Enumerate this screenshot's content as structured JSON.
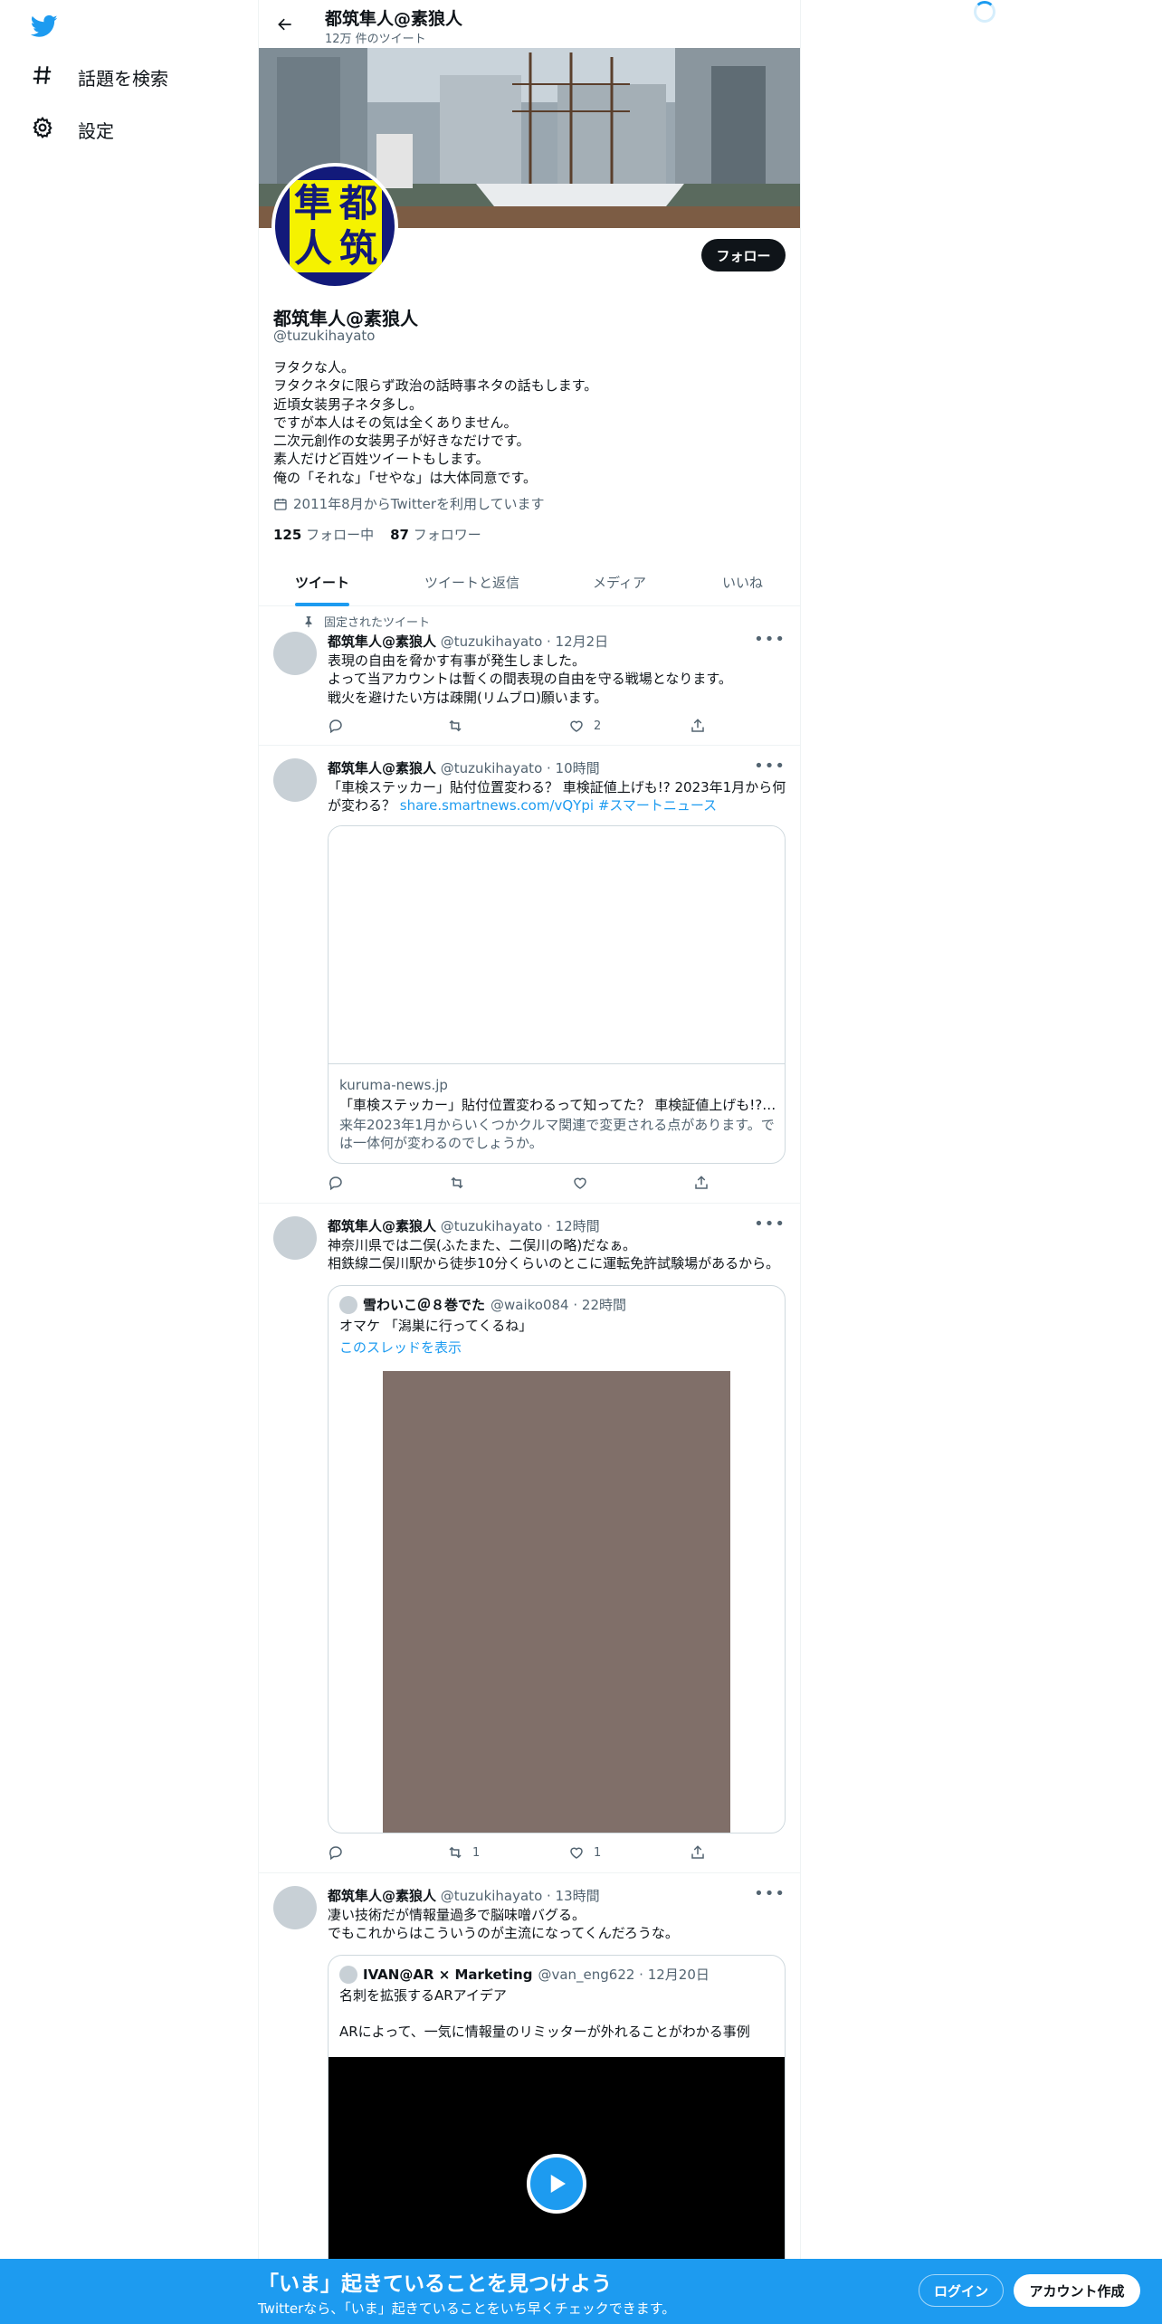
{
  "nav": {
    "items": [
      {
        "label": "話題を検索"
      },
      {
        "label": "設定"
      }
    ]
  },
  "header": {
    "title": "都筑隼人@素狼人",
    "subtitle": "12万 件のツイート"
  },
  "profile": {
    "avatar_text": [
      "隼",
      "都",
      "人",
      "筑"
    ],
    "follow_label": "フォロー",
    "name": "都筑隼人@素狼人",
    "handle": "@tuzukihayato",
    "bio": [
      "ヲタクな人。",
      "ヲタクネタに限らず政治の話時事ネタの話もします。",
      "近頃女装男子ネタ多し。",
      "ですが本人はその気は全くありません。",
      "二次元創作の女装男子が好きなだけです。",
      "素人だけど百姓ツイートもします。",
      "俺の「それな」「せやな」は大体同意です。"
    ],
    "joined": "2011年8月からTwitterを利用しています",
    "following_count": "125",
    "following_label": "フォロー中",
    "followers_count": "87",
    "followers_label": "フォロワー"
  },
  "tabs": [
    {
      "label": "ツイート",
      "active": true
    },
    {
      "label": "ツイートと返信",
      "active": false
    },
    {
      "label": "メディア",
      "active": false
    },
    {
      "label": "いいね",
      "active": false
    }
  ],
  "tweets": [
    {
      "pinned_label": "固定されたツイート",
      "name": "都筑隼人@素狼人",
      "meta": "@tuzukihayato · 12月2日",
      "lines": [
        "表現の自由を脅かす有事が発生しました。",
        "よって当アカウントは暫くの間表現の自由を守る戦場となります。",
        "戦火を避けたい方は疎開(リムブロ)願います。"
      ],
      "retweets": "",
      "likes": "2"
    },
    {
      "name": "都筑隼人@素狼人",
      "meta": "@tuzukihayato · 10時間",
      "lines": [
        "「車検ステッカー」貼付位置変わる？ 車検証値上げも!? 2023年1月から何",
        "が変わる？"
      ],
      "link": "share.smartnews.com/vQYpi",
      "hashtag": "#スマートニュース",
      "card": {
        "domain": "kuruma-news.jp",
        "title": "「車検ステッカー」貼付位置変わるって知ってた？ 車検証値上げも!?…",
        "desc": [
          "来年2023年1月からいくつかクルマ関連で変更される点があります。で",
          "は一体何が変わるのでしょうか。"
        ]
      },
      "retweets": "",
      "likes": ""
    },
    {
      "name": "都筑隼人@素狼人",
      "meta": "@tuzukihayato · 12時間",
      "lines": [
        "神奈川県では二俣(ふたまた、二俣川の略)だなぁ。",
        "相鉄線二俣川駅から徒歩10分くらいのとこに運転免許試験場があるから。"
      ],
      "quote": {
        "name": "雪わいこ＠８巻でた",
        "meta": "@waiko084 · 22時間",
        "text": "オマケ 「潟巣に行ってくるね」",
        "thread_link": "このスレッドを表示"
      },
      "retweets": "1",
      "likes": "1"
    },
    {
      "name": "都筑隼人@素狼人",
      "meta": "@tuzukihayato · 13時間",
      "lines": [
        "凄い技術だが情報量過多で脳味噌バグる。",
        "でもこれからはこういうのが主流になってくんだろうな。"
      ],
      "quote": {
        "name": "IVAN@AR × Marketing",
        "meta": "@van_eng622 · 12月20日",
        "lines": [
          "名刺を拡張するARアイデア",
          "",
          "ARによって、一気に情報量のリミッターが外れることがわかる事例"
        ]
      }
    }
  ],
  "bottom_bar": {
    "title": "「いま」起きていることを見つけよう",
    "subtitle": "Twitterなら、「いま」起きていることをいち早くチェックできます。",
    "login": "ログイン",
    "signup": "アカウント作成"
  },
  "colors": {
    "accent": "#1d9bf0",
    "text": "#0f1419",
    "muted": "#536471",
    "border": "#eff3f4"
  }
}
